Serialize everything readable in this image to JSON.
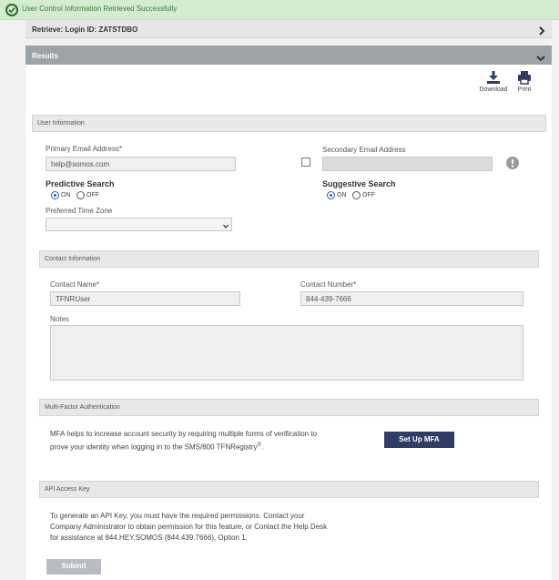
{
  "banner": {
    "message": "User Control Information Retrieved Successfully"
  },
  "retrieve": {
    "title": "Retrieve: Login ID: ZATSTDBO"
  },
  "results": {
    "title": "Results",
    "download_label": "Download",
    "print_label": "Print"
  },
  "user_info": {
    "header": "User Information",
    "primary_email_label": "Primary Email Address*",
    "primary_email_value": "help@somos.com",
    "secondary_email_label": "Secondary Email Address",
    "secondary_email_value": "",
    "predictive_label": "Predictive Search",
    "suggestive_label": "Suggestive Search",
    "on_label": "ON",
    "off_label": "OFF",
    "timezone_label": "Preferred Time Zone",
    "timezone_value": ""
  },
  "contact": {
    "header": "Contact Information",
    "name_label": "Contact Name*",
    "name_value": "TFNRUser",
    "number_label": "Contact Number*",
    "number_value": "844-439-7666",
    "notes_label": "Notes",
    "notes_value": ""
  },
  "mfa": {
    "header": "Multi-Factor Authentication",
    "text_1": "MFA helps to increase account security by requiring multiple forms of verification to",
    "text_2": "prove your identity when logging in to the SMS/800 TFNRegistry",
    "registered_mark": "®",
    "text_end": ".",
    "button_label": "Set Up MFA"
  },
  "api": {
    "header": "API Access Key",
    "line_1": "To generate an API Key, you must have the required permissions. Contact your",
    "line_2": "Company Administrator to obtain permission for this feature, or Contact the Help Desk",
    "line_3": "for assistance at 844.HEY.SOMOS (844.439.7666), Option 1.",
    "submit_label": "Submit"
  },
  "colors": {
    "banner_bg": "#d4ecd0",
    "results_bar": "#9ea3a8",
    "mfa_button": "#2f3d66",
    "radio_on": "#2a5fb0"
  }
}
